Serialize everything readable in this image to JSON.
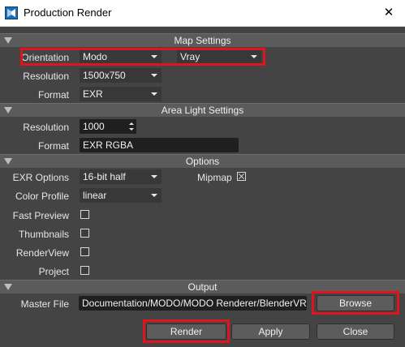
{
  "window": {
    "title": "Production Render",
    "close_glyph": "✕",
    "app_icon": "modo-app-icon"
  },
  "map_settings": {
    "header": "Map Settings",
    "orientation": {
      "label": "Orientation",
      "value1": "Modo",
      "value2": "Vray"
    },
    "resolution": {
      "label": "Resolution",
      "value": "1500x750"
    },
    "format": {
      "label": "Format",
      "value": "EXR"
    }
  },
  "area_light_settings": {
    "header": "Area Light Settings",
    "resolution": {
      "label": "Resolution",
      "value": "1000"
    },
    "format": {
      "label": "Format",
      "value": "EXR RGBA"
    }
  },
  "options": {
    "header": "Options",
    "exr_options": {
      "label": "EXR Options",
      "value": "16-bit half"
    },
    "mipmap": {
      "label": "Mipmap",
      "checked": true
    },
    "color_profile": {
      "label": "Color Profile",
      "value": "linear"
    },
    "fast_preview": {
      "label": "Fast Preview",
      "checked": false
    },
    "thumbnails": {
      "label": "Thumbnails",
      "checked": false
    },
    "renderview": {
      "label": "RenderView",
      "checked": false
    },
    "project": {
      "label": "Project",
      "checked": false
    }
  },
  "output": {
    "header": "Output",
    "master_file": {
      "label": "Master File",
      "value": "Documentation/MODO/MODO Renderer/BlenderVRay.exr"
    },
    "browse_label": "Browse"
  },
  "actions": {
    "render_label": "Render",
    "apply_label": "Apply",
    "close_label": "Close"
  },
  "colors": {
    "highlight": "#e0141e",
    "panel_bg": "#444444",
    "header_bg": "#5b5b5b"
  }
}
